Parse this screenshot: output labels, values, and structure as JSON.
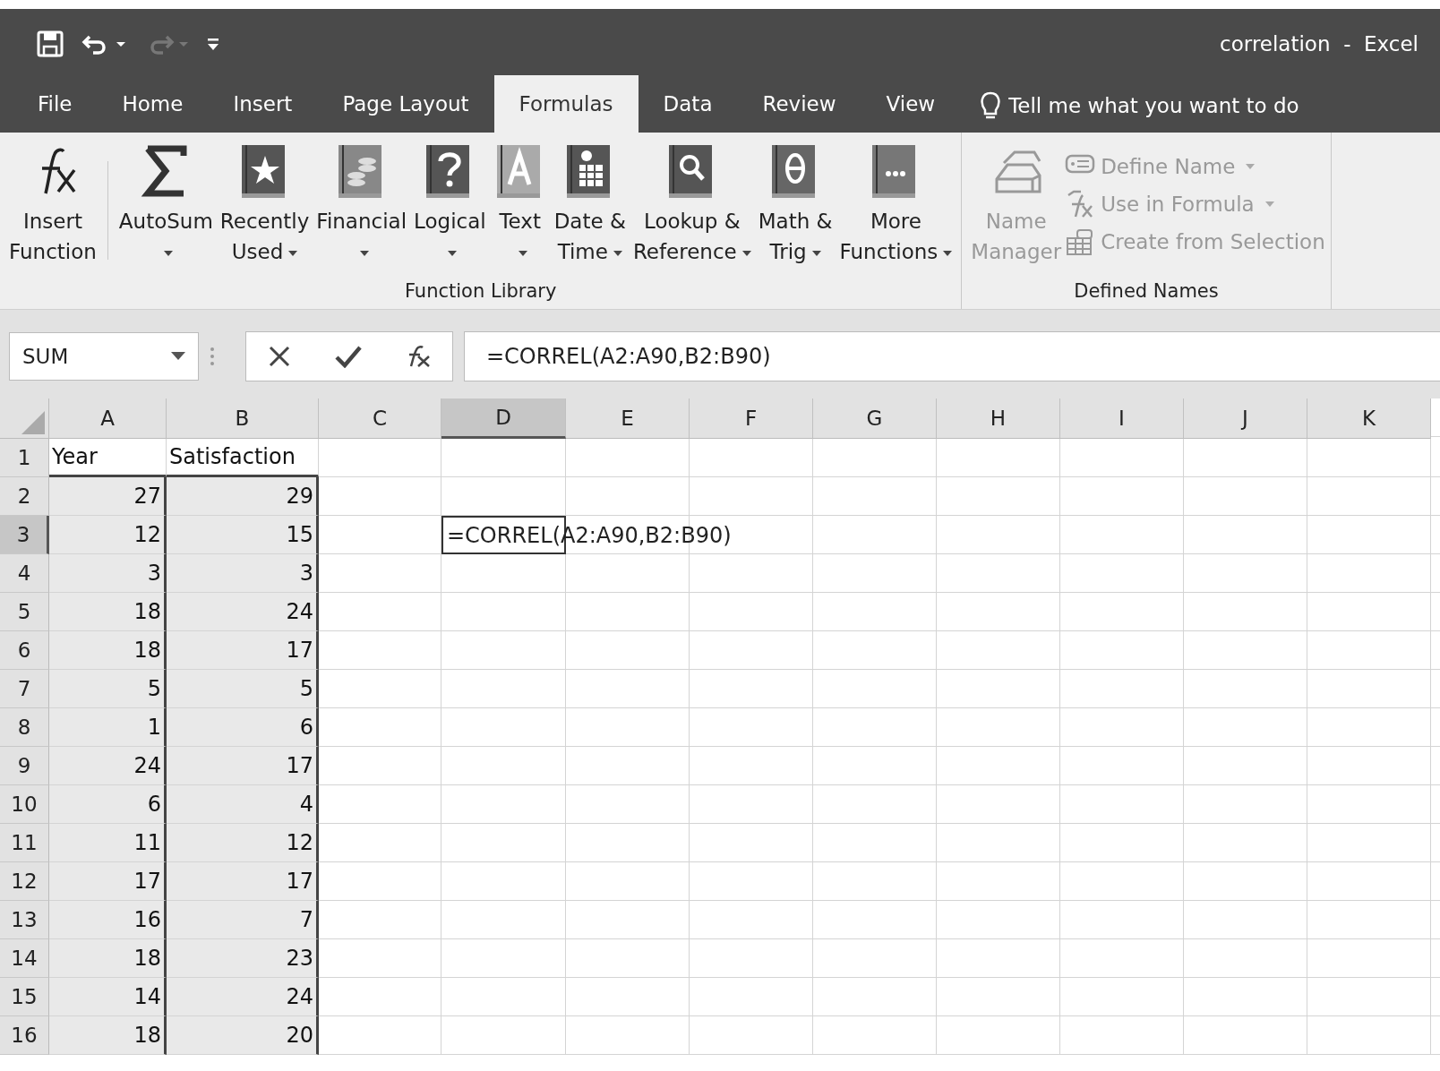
{
  "window": {
    "title": "correlation  -  Excel"
  },
  "tabs": [
    {
      "label": "File",
      "selected": false
    },
    {
      "label": "Home",
      "selected": false
    },
    {
      "label": "Insert",
      "selected": false
    },
    {
      "label": "Page Layout",
      "selected": false
    },
    {
      "label": "Formulas",
      "selected": true
    },
    {
      "label": "Data",
      "selected": false
    },
    {
      "label": "Review",
      "selected": false
    },
    {
      "label": "View",
      "selected": false
    }
  ],
  "tell_me": {
    "placeholder": "Tell me what you want to do"
  },
  "ribbon": {
    "groups": [
      {
        "label": "Function Library",
        "buttons": [
          {
            "kind": "fx",
            "lines": [
              "Insert",
              "Function"
            ],
            "dropdown": false,
            "disabled": false
          },
          {
            "kind": "sigma",
            "lines": [
              "AutoSum"
            ],
            "dropdown": true,
            "disabled": false
          },
          {
            "kind": "star",
            "lines": [
              "Recently",
              "Used"
            ],
            "dropdown": true,
            "disabled": false
          },
          {
            "kind": "coins",
            "lines": [
              "Financial"
            ],
            "dropdown": true,
            "disabled": false
          },
          {
            "kind": "question",
            "lines": [
              "Logical"
            ],
            "dropdown": true,
            "disabled": false
          },
          {
            "kind": "letter",
            "lines": [
              "Text"
            ],
            "dropdown": true,
            "disabled": false
          },
          {
            "kind": "calendar",
            "lines": [
              "Date &",
              "Time"
            ],
            "dropdown": true,
            "disabled": false
          },
          {
            "kind": "magnifier",
            "lines": [
              "Lookup &",
              "Reference"
            ],
            "dropdown": true,
            "disabled": false
          },
          {
            "kind": "theta",
            "lines": [
              "Math &",
              "Trig"
            ],
            "dropdown": true,
            "disabled": false
          },
          {
            "kind": "dots",
            "lines": [
              "More",
              "Functions"
            ],
            "dropdown": true,
            "disabled": false
          }
        ]
      },
      {
        "label": "Defined Names",
        "buttons": [
          {
            "kind": "tags",
            "lines": [
              "Name",
              "Manager"
            ],
            "dropdown": false,
            "disabled": true
          }
        ],
        "small_buttons": [
          {
            "kind": "tag",
            "label": "Define Name",
            "dropdown": true,
            "disabled": true
          },
          {
            "kind": "fxtag",
            "label": "Use in Formula",
            "dropdown": true,
            "disabled": true
          },
          {
            "kind": "table",
            "label": "Create from Selection",
            "dropdown": false,
            "disabled": true
          }
        ]
      }
    ]
  },
  "formula_bar": {
    "name_box": "SUM",
    "formula": "=CORREL(A2:A90,B2:B90)"
  },
  "grid": {
    "columns": [
      {
        "label": "A",
        "selected": false,
        "referenced": true
      },
      {
        "label": "B",
        "selected": false,
        "referenced": true
      },
      {
        "label": "C",
        "selected": false,
        "referenced": false
      },
      {
        "label": "D",
        "selected": true,
        "referenced": false
      },
      {
        "label": "E",
        "selected": false,
        "referenced": false
      },
      {
        "label": "F",
        "selected": false,
        "referenced": false
      },
      {
        "label": "G",
        "selected": false,
        "referenced": false
      },
      {
        "label": "H",
        "selected": false,
        "referenced": false
      },
      {
        "label": "I",
        "selected": false,
        "referenced": false
      },
      {
        "label": "J",
        "selected": false,
        "referenced": false
      },
      {
        "label": "K",
        "selected": false,
        "referenced": false
      }
    ],
    "rows": [
      {
        "number": "1",
        "selected": false,
        "kind": "header",
        "cells": [
          "Year",
          "Satisfaction"
        ]
      },
      {
        "number": "2",
        "selected": false,
        "kind": "data",
        "cells": [
          "27",
          "29"
        ]
      },
      {
        "number": "3",
        "selected": true,
        "kind": "data",
        "cells": [
          "12",
          "15"
        ],
        "editing": "=CORREL(A2:A90,B2:B90)"
      },
      {
        "number": "4",
        "selected": false,
        "kind": "data",
        "cells": [
          "3",
          "3"
        ]
      },
      {
        "number": "5",
        "selected": false,
        "kind": "data",
        "cells": [
          "18",
          "24"
        ]
      },
      {
        "number": "6",
        "selected": false,
        "kind": "data",
        "cells": [
          "18",
          "17"
        ]
      },
      {
        "number": "7",
        "selected": false,
        "kind": "data",
        "cells": [
          "5",
          "5"
        ]
      },
      {
        "number": "8",
        "selected": false,
        "kind": "data",
        "cells": [
          "1",
          "6"
        ]
      },
      {
        "number": "9",
        "selected": false,
        "kind": "data",
        "cells": [
          "24",
          "17"
        ]
      },
      {
        "number": "10",
        "selected": false,
        "kind": "data",
        "cells": [
          "6",
          "4"
        ]
      },
      {
        "number": "11",
        "selected": false,
        "kind": "data",
        "cells": [
          "11",
          "12"
        ]
      },
      {
        "number": "12",
        "selected": false,
        "kind": "data",
        "cells": [
          "17",
          "17"
        ]
      },
      {
        "number": "13",
        "selected": false,
        "kind": "data",
        "cells": [
          "16",
          "7"
        ]
      },
      {
        "number": "14",
        "selected": false,
        "kind": "data",
        "cells": [
          "18",
          "23"
        ]
      },
      {
        "number": "15",
        "selected": false,
        "kind": "data",
        "cells": [
          "14",
          "24"
        ]
      },
      {
        "number": "16",
        "selected": false,
        "kind": "data",
        "cells": [
          "18",
          "20"
        ]
      }
    ]
  }
}
